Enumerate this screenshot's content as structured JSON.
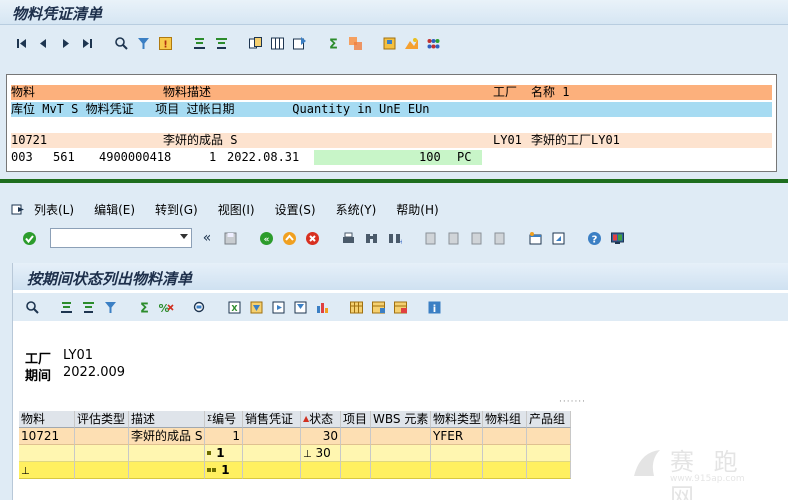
{
  "top": {
    "title": "物料凭证清单",
    "list": {
      "header1": {
        "material": "物料",
        "desc": "物料描述",
        "plant": "工厂",
        "name": "名称 1"
      },
      "header2": {
        "text": "库位 MvT S 物料凭证   项目 过帐日期        Quantity in UnE EUn"
      },
      "row1": {
        "material": "10721",
        "desc": "李妍的成品 S",
        "plant": "LY01",
        "plant_name": "李妍的工厂LY01"
      },
      "row2": {
        "sloc": "003",
        "mvt": "561",
        "doc": "4900000418",
        "item": "1",
        "date": "2022.08.31",
        "qty": "100",
        "unit": "PC"
      }
    }
  },
  "menu": {
    "items": [
      "列表(L)",
      "编辑(E)",
      "转到(G)",
      "视图(I)",
      "设置(S)",
      "系统(Y)",
      "帮助(H)"
    ]
  },
  "command": {
    "value": ""
  },
  "report": {
    "title": "按期间状态列出物料清单",
    "info": {
      "plant_label": "工厂",
      "plant_value": "LY01",
      "period_label": "期间",
      "period_value": "2022.009"
    },
    "columns": [
      "物料",
      "评估类型",
      "描述",
      "编号",
      "销售凭证",
      "状态",
      "项目",
      "WBS 元素",
      "物料类型",
      "物料组",
      "产品组"
    ],
    "rows": [
      {
        "material": "10721",
        "desc": "李妍的成品 S",
        "count": "1",
        "status": "30",
        "mtype": "YFER"
      },
      {
        "count": "1",
        "status": "30"
      },
      {
        "count": "1"
      }
    ]
  },
  "watermark": {
    "text": "赛 跑 网",
    "url": "www.915ap.com"
  },
  "colors": {
    "header_orange": "#fcb07c",
    "header_blue": "#a6dbf2",
    "row_peach": "#fde3cf",
    "qty_green": "#c8f5c8",
    "divider": "#1e6e1e"
  }
}
